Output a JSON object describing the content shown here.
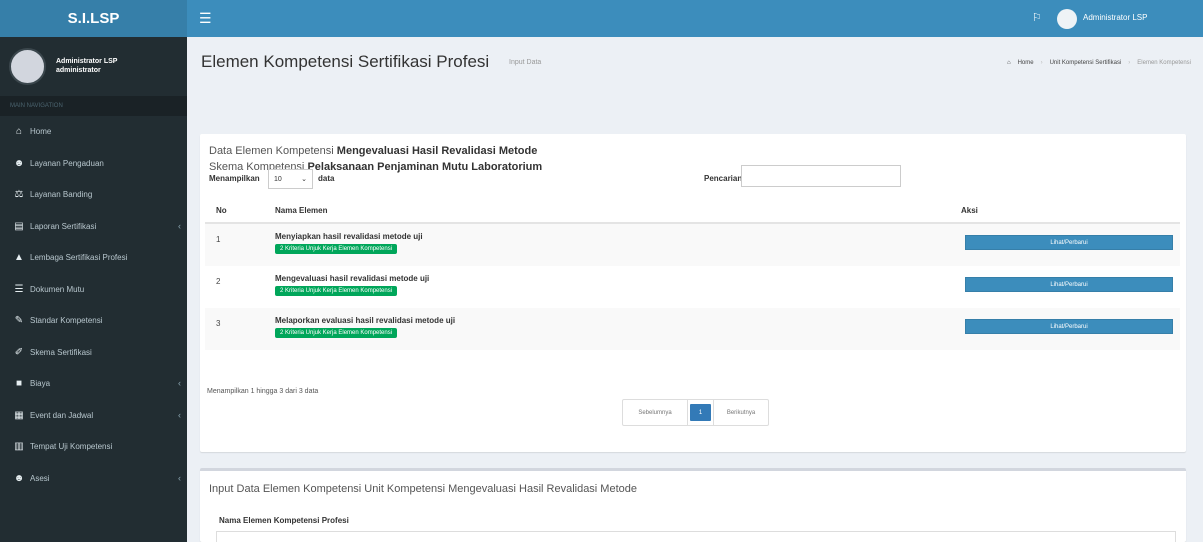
{
  "brand": "S.I.LSP",
  "user": {
    "name": "Administrator LSP",
    "role": "administrator",
    "top_name": "Administrator LSP"
  },
  "sidebar": {
    "header": "MAIN NAVIGATION",
    "items": [
      {
        "label": "Home",
        "icon": "home-icon",
        "glyph": "⌂",
        "submenu": false
      },
      {
        "label": "Layanan Pengaduan",
        "icon": "users-icon",
        "glyph": "☻",
        "submenu": false
      },
      {
        "label": "Layanan Banding",
        "icon": "balance-icon",
        "glyph": "⚖",
        "submenu": false
      },
      {
        "label": "Laporan Sertifikasi",
        "icon": "book-icon",
        "glyph": "▤",
        "submenu": true
      },
      {
        "label": "Lembaga Sertifikasi Profesi",
        "icon": "graduation-cap-icon",
        "glyph": "▲",
        "submenu": false
      },
      {
        "label": "Dokumen Mutu",
        "icon": "list-icon",
        "glyph": "☰",
        "submenu": false
      },
      {
        "label": "Standar Kompetensi",
        "icon": "wrench-icon",
        "glyph": "✎",
        "submenu": false
      },
      {
        "label": "Skema Sertifikasi",
        "icon": "edit-icon",
        "glyph": "✐",
        "submenu": false
      },
      {
        "label": "Biaya",
        "icon": "money-icon",
        "glyph": "■",
        "submenu": true
      },
      {
        "label": "Event dan Jadwal",
        "icon": "calendar-icon",
        "glyph": "▦",
        "submenu": true
      },
      {
        "label": "Tempat Uji Kompetensi",
        "icon": "building-icon",
        "glyph": "▥",
        "submenu": false
      },
      {
        "label": "Asesi",
        "icon": "users-icon",
        "glyph": "☻",
        "submenu": true
      }
    ]
  },
  "header": {
    "title": "Elemen Kompetensi Sertifikasi Profesi",
    "subtitle": "Input Data",
    "breadcrumb": [
      "Home",
      "Unit Kompetensi Sertifikasi",
      "Elemen Kompetensi"
    ]
  },
  "box1": {
    "line1_prefix": "Data Elemen Kompetensi ",
    "line1_bold": "Mengevaluasi Hasil Revalidasi Metode",
    "line2_prefix": "Skema Kompetensi ",
    "line2_bold": "Pelaksanaan Penjaminan Mutu Laboratorium",
    "length_label": "Menampilkan",
    "length_value": "10",
    "length_after": "data",
    "search_label": "Pencarian:",
    "columns": [
      "No",
      "Nama Elemen",
      "Aksi"
    ],
    "rows": [
      {
        "no": "1",
        "name": "Menyiapkan hasil revalidasi metode uji",
        "badge": "2 Kriteria Unjuk Kerja Elemen Kompetensi",
        "action": "Lihat/Perbarui"
      },
      {
        "no": "2",
        "name": "Mengevaluasi hasil revalidasi metode uji",
        "badge": "2 Kriteria Unjuk Kerja Elemen Kompetensi",
        "action": "Lihat/Perbarui"
      },
      {
        "no": "3",
        "name": "Melaporkan evaluasi hasil revalidasi metode uji",
        "badge": "2 Kriteria Unjuk Kerja Elemen Kompetensi",
        "action": "Lihat/Perbarui"
      }
    ],
    "info": "Menampilkan 1 hingga 3 dari 3 data",
    "pager": {
      "prev": "Sebelumnya",
      "current": "1",
      "next": "Berikutnya"
    }
  },
  "box2": {
    "title": "Input Data Elemen Kompetensi Unit Kompetensi Mengevaluasi Hasil Revalidasi Metode",
    "field_label": "Nama Elemen Kompetensi Profesi"
  },
  "colors": {
    "primary": "#3c8dbc",
    "sidebar": "#222d32",
    "success": "#00a65a"
  }
}
